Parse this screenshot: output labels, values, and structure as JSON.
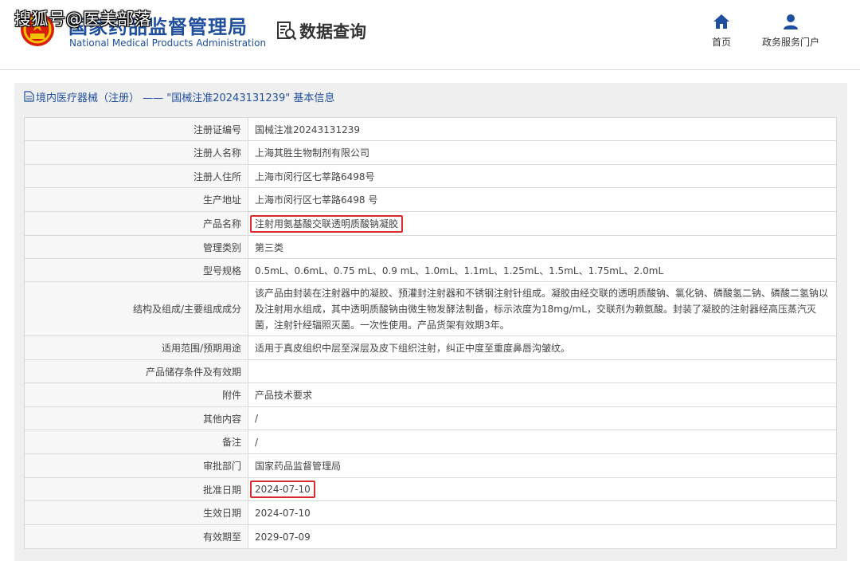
{
  "watermark": "搜狐号@医美部落",
  "header": {
    "logo_cn": "国家药品监督管理局",
    "logo_en": "National Medical Products Administration",
    "query_label": "数据查询",
    "nav": [
      {
        "label": "首页",
        "icon": "home-icon"
      },
      {
        "label": "政务服务门户",
        "icon": "user-icon"
      }
    ]
  },
  "panel": {
    "title": "境内医疗器械（注册） —— \"国械注准20243131239\" 基本信息"
  },
  "rows": [
    {
      "label": "注册证编号",
      "value": "国械注准20243131239"
    },
    {
      "label": "注册人名称",
      "value": "上海其胜生物制剂有限公司"
    },
    {
      "label": "注册人住所",
      "value": "上海市闵行区七莘路6498号"
    },
    {
      "label": "生产地址",
      "value": "上海市闵行区七莘路6498 号"
    },
    {
      "label": "产品名称",
      "value": "注射用氨基酸交联透明质酸钠凝胶"
    },
    {
      "label": "管理类别",
      "value": "第三类"
    },
    {
      "label": "型号规格",
      "value": "0.5mL、0.6mL、0.75 mL、0.9 mL、1.0mL、1.1mL、1.25mL、1.5mL、1.75mL、2.0mL"
    },
    {
      "label": "结构及组成/主要组成成分",
      "value": "该产品由封装在注射器中的凝胶、预灌封注射器和不锈钢注射针组成。凝胶由经交联的透明质酸钠、氯化钠、磷酸氢二钠、磷酸二氢钠以及注射用水组成，其中透明质酸钠由微生物发酵法制备，标示浓度为18mg/mL，交联剂为赖氨酸。封装了凝胶的注射器经高压蒸汽灭菌，注射针经辐照灭菌。一次性使用。产品货架有效期3年。"
    },
    {
      "label": "适用范围/预期用途",
      "value": "适用于真皮组织中层至深层及皮下组织注射，纠正中度至重度鼻唇沟皱纹。"
    },
    {
      "label": "产品储存条件及有效期",
      "value": ""
    },
    {
      "label": "附件",
      "value": "产品技术要求"
    },
    {
      "label": "其他内容",
      "value": "/"
    },
    {
      "label": "备注",
      "value": "/"
    },
    {
      "label": "审批部门",
      "value": "国家药品监督管理局"
    },
    {
      "label": "批准日期",
      "value": "2024-07-10"
    },
    {
      "label": "生效日期",
      "value": "2024-07-10"
    },
    {
      "label": "有效期至",
      "value": "2029-07-09"
    }
  ],
  "highlight_color": "#d92b2b"
}
